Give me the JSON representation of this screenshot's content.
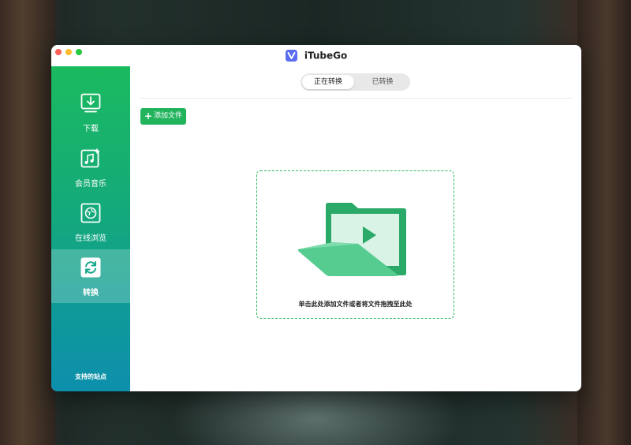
{
  "app": {
    "title": "iTubeGo"
  },
  "sidebar": {
    "items": [
      {
        "label": "下载",
        "icon": "download-icon",
        "active": false
      },
      {
        "label": "会员音乐",
        "icon": "music-icon",
        "active": false
      },
      {
        "label": "在线浏览",
        "icon": "browser-icon",
        "active": false
      },
      {
        "label": "转换",
        "icon": "convert-icon",
        "active": true
      }
    ],
    "supported_sites": "支持的站点"
  },
  "main": {
    "tabs": [
      {
        "label": "正在转换",
        "selected": true
      },
      {
        "label": "已转换",
        "selected": false
      }
    ],
    "add_file_label": "添加文件",
    "drop_hint": "单击此处添加文件或者将文件拖拽至此处"
  },
  "colors": {
    "accent": "#22b45d",
    "sidebar_top": "#1bba5f",
    "sidebar_bottom": "#0d8fad"
  }
}
